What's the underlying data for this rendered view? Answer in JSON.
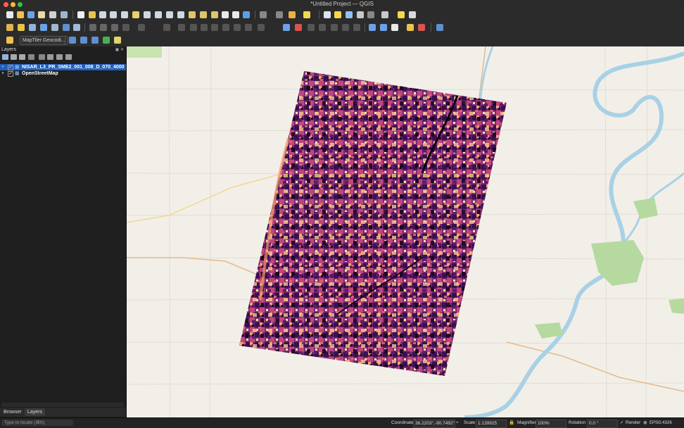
{
  "window": {
    "title": "*Untitled Project — QGIS"
  },
  "toolbar": {
    "geocoder_label": "MapTiler Geocodi..."
  },
  "layers_panel": {
    "title": "Layers",
    "layers": [
      {
        "name": "NISAR_L3_PR_SME2_001_008_D_070_4000",
        "checked": "✓"
      },
      {
        "name": "OpenStreetMap",
        "checked": "✓"
      }
    ]
  },
  "bottom_tabs": {
    "browser": "Browser",
    "layers": "Layers"
  },
  "statusbar": {
    "locate_placeholder": "Type to locate (⌘K)",
    "coordinate_label": "Coordinate",
    "coordinate_value": "36.2203°,-90.7492°",
    "scale_label": "Scale",
    "scale_value": "1:139925",
    "magnifier_label": "Magnifier",
    "magnifier_value": "100%",
    "rotation_label": "Rotation",
    "rotation_value": "0.0 °",
    "render_label": "Render",
    "crs_label": "EPSG:4326"
  },
  "colors": {
    "selection": "#1f5fbf",
    "raster_dark": "#2a0b3d",
    "raster_mid": "#9c2f7c",
    "raster_bright": "#f7d3a0",
    "river": "#a9d1e6",
    "park": "#b6d9a0"
  }
}
